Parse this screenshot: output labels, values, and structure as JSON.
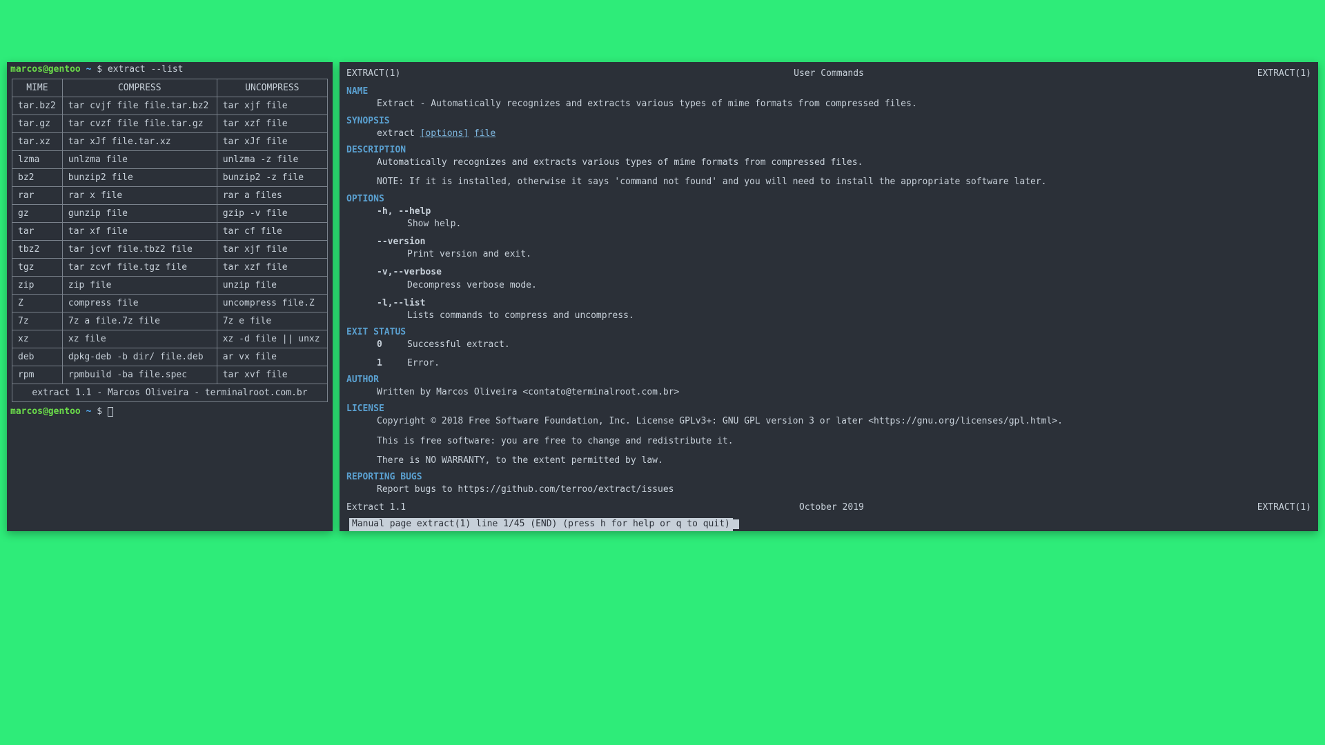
{
  "prompt": {
    "user": "marcos",
    "at": "@",
    "host": "gentoo",
    "path": "~",
    "dollar": "$",
    "command": "extract --list"
  },
  "headers": {
    "mime": "MIME",
    "compress": "COMPRESS",
    "uncompress": "UNCOMPRESS"
  },
  "rows": [
    {
      "m": "tar.bz2",
      "c": "tar cvjf file file.tar.bz2",
      "u": "tar xjf file"
    },
    {
      "m": "tar.gz",
      "c": "tar cvzf file file.tar.gz",
      "u": "tar xzf file"
    },
    {
      "m": "tar.xz",
      "c": "tar xJf file.tar.xz",
      "u": "tar xJf file"
    },
    {
      "m": "lzma",
      "c": "unlzma  file",
      "u": "unlzma -z file"
    },
    {
      "m": "bz2",
      "c": "bunzip2 file",
      "u": "bunzip2 -z file"
    },
    {
      "m": "rar",
      "c": "rar x file",
      "u": "rar a files"
    },
    {
      "m": "gz",
      "c": "gunzip file",
      "u": "gzip -v file"
    },
    {
      "m": "tar",
      "c": "tar xf file",
      "u": "tar cf file"
    },
    {
      "m": "tbz2",
      "c": "tar jcvf file.tbz2 file",
      "u": "tar xjf file"
    },
    {
      "m": "tgz",
      "c": "tar zcvf file.tgz file",
      "u": "tar xzf file"
    },
    {
      "m": "zip",
      "c": "zip file",
      "u": "unzip file"
    },
    {
      "m": "Z",
      "c": "compress file",
      "u": "uncompress file.Z"
    },
    {
      "m": "7z",
      "c": "7z a file.7z file",
      "u": "7z e file"
    },
    {
      "m": "xz",
      "c": "xz file",
      "u": "xz -d file || unxz"
    },
    {
      "m": "deb",
      "c": "dpkg-deb -b dir/ file.deb",
      "u": "ar vx file"
    },
    {
      "m": "rpm",
      "c": "rpmbuild -ba file.spec",
      "u": "tar xvf file"
    }
  ],
  "footer": "extract 1.1 - Marcos Oliveira - terminalroot.com.br",
  "man": {
    "head_left": "EXTRACT(1)",
    "head_center": "User Commands",
    "head_right": "EXTRACT(1)",
    "name_title": "NAME",
    "name_text": "Extract - Automatically recognizes and extracts various types of mime formats from compressed files.",
    "synopsis_title": "SYNOPSIS",
    "synopsis_cmd": "extract",
    "synopsis_opts": "[options]",
    "synopsis_file": "file",
    "desc_title": "DESCRIPTION",
    "desc_text1": "Automatically recognizes and extracts various types of mime formats from compressed files.",
    "desc_text2": "NOTE: If it is installed, otherwise it says 'command not found' and you will need to install the appropriate software later.",
    "options_title": "OPTIONS",
    "opt1": "-h, --help",
    "opt1d": "Show help.",
    "opt2": "--version",
    "opt2d": "Print version and exit.",
    "opt3": "-v,--verbose",
    "opt3d": "Decompress verbose mode.",
    "opt4": "-l,--list",
    "opt4d": "Lists commands to compress and uncompress.",
    "exit_title": "EXIT STATUS",
    "exit0": "0",
    "exit0d": "Successful extract.",
    "exit1": "1",
    "exit1d": "Error.",
    "author_title": "AUTHOR",
    "author_text": "Written by Marcos Oliveira <contato@terminalroot.com.br>",
    "license_title": "LICENSE",
    "license_text1": "Copyright © 2018 Free Software Foundation, Inc.  License GPLv3+: GNU GPL version 3 or later <https://gnu.org/licenses/gpl.html>.",
    "license_text2": "This is free software: you are free to change and redistribute it.",
    "license_text3": "There is NO WARRANTY, to the extent permitted by law.",
    "bugs_title": "REPORTING BUGS",
    "bugs_text": "Report bugs to https://github.com/terroo/extract/issues",
    "foot_left": "Extract 1.1",
    "foot_center": "October 2019",
    "foot_right": "EXTRACT(1)",
    "statusbar": " Manual page extract(1) line 1/45 (END) (press h for help or q to quit)"
  }
}
